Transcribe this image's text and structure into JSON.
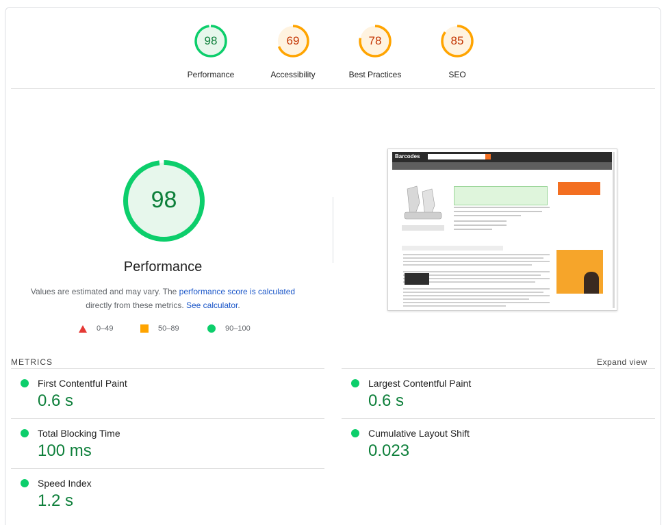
{
  "scores": [
    {
      "value": "98",
      "label": "Performance",
      "color": "#0cce6b",
      "text_color": "#0d7f3a",
      "bg": "#e7f7ec",
      "fraction": 0.98
    },
    {
      "value": "69",
      "label": "Accessibility",
      "color": "#ffa400",
      "text_color": "#c33300",
      "bg": "#fff3e0",
      "fraction": 0.69
    },
    {
      "value": "78",
      "label": "Best Practices",
      "color": "#ffa400",
      "text_color": "#c33300",
      "bg": "#fff3e0",
      "fraction": 0.78
    },
    {
      "value": "85",
      "label": "SEO",
      "color": "#ffa400",
      "text_color": "#c33300",
      "bg": "#fff3e0",
      "fraction": 0.85
    }
  ],
  "performance": {
    "score": "98",
    "fraction": 0.98,
    "title": "Performance",
    "desc_prefix": "Values are estimated and may vary. The ",
    "desc_link": "performance score is calculated",
    "desc_middle": "directly from these metrics. ",
    "desc_link2": "See calculator",
    "desc_suffix": "."
  },
  "legend": {
    "fail": "0–49",
    "average": "50–89",
    "pass": "90–100"
  },
  "thumbnail": {
    "logo": "Barcodes"
  },
  "metrics": {
    "title": "METRICS",
    "expand": "Expand view",
    "items": [
      {
        "label": "First Contentful Paint",
        "value": "0.6 s"
      },
      {
        "label": "Largest Contentful Paint",
        "value": "0.6 s"
      },
      {
        "label": "Total Blocking Time",
        "value": "100 ms"
      },
      {
        "label": "Cumulative Layout Shift",
        "value": "0.023"
      },
      {
        "label": "Speed Index",
        "value": "1.2 s"
      }
    ]
  },
  "colors": {
    "pass": "#0cce6b",
    "average": "#ffa400",
    "fail": "#e53935",
    "link": "#1a56c8"
  }
}
